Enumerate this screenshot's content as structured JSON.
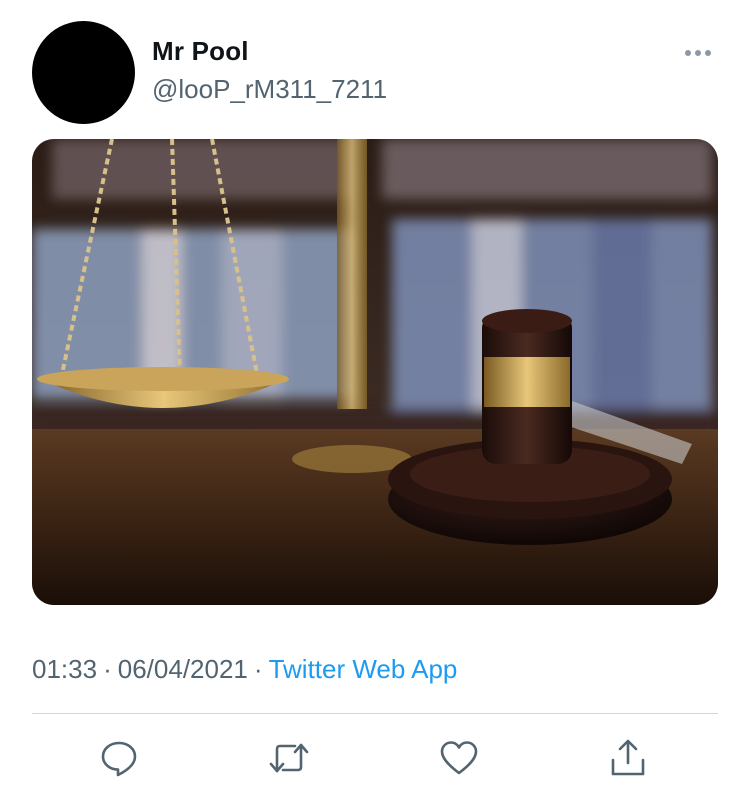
{
  "tweet": {
    "display_name": "Mr Pool",
    "handle": "@looP_rM311_7211",
    "time": "01:33",
    "date": "06/04/2021",
    "separator": "·",
    "source": "Twitter Web App"
  },
  "media": {
    "description_icon": "photo-image"
  },
  "actions": [
    {
      "name": "reply",
      "icon": "speech-bubble-icon"
    },
    {
      "name": "retweet",
      "icon": "retweet-arrows-icon"
    },
    {
      "name": "like",
      "icon": "heart-icon"
    },
    {
      "name": "share",
      "icon": "share-upload-icon"
    }
  ],
  "colors": {
    "accent": "#1d9bf0",
    "secondary_text": "#536471",
    "icon": "#536471",
    "divider": "#cfd9de"
  }
}
